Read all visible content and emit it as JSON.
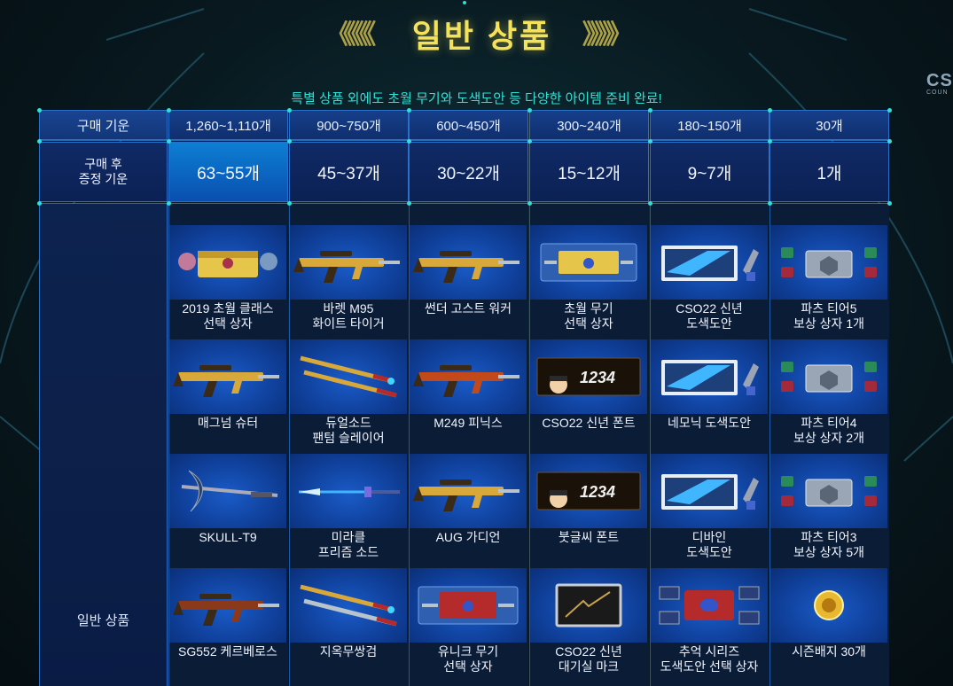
{
  "header": {
    "title": "일반 상품",
    "left_deco": "《《《《",
    "right_deco": "》》》》",
    "subtitle": "특별 상품 외에도 초월 무기와 도색도안 등 다양한 아이템 준비 완료!"
  },
  "brand": {
    "text": "CS",
    "sub": "COUN"
  },
  "table": {
    "row_label_purchase": "구매 기운",
    "row_label_bonus_line1": "구매 후",
    "row_label_bonus_line2": "증정 기운",
    "section_label": "일반 상품",
    "columns": [
      {
        "purchase": "1,260~1,110개",
        "bonus": "63~55개"
      },
      {
        "purchase": "900~750개",
        "bonus": "45~37개"
      },
      {
        "purchase": "600~450개",
        "bonus": "30~22개"
      },
      {
        "purchase": "300~240개",
        "bonus": "15~12개"
      },
      {
        "purchase": "180~150개",
        "bonus": "9~7개"
      },
      {
        "purchase": "30개",
        "bonus": "1개"
      }
    ],
    "rows": [
      [
        {
          "line1": "2019 초월 클래스",
          "line2": "선택 상자",
          "icon": "gold-chest-icon"
        },
        {
          "line1": "바렛 M95",
          "line2": "화이트 타이거",
          "icon": "sniper-rifle-icon"
        },
        {
          "line1": "썬더 고스트 워커",
          "line2": "",
          "icon": "heavy-rifle-icon"
        },
        {
          "line1": "초월 무기",
          "line2": "선택 상자",
          "icon": "weapon-box-icon"
        },
        {
          "line1": "CSO22 신년",
          "line2": "도색도안",
          "icon": "paint-card-icon"
        },
        {
          "line1": "파츠 티어5",
          "line2": "보상 상자 1개",
          "icon": "parts-box-icon"
        }
      ],
      [
        {
          "line1": "매그넘 슈터",
          "line2": "",
          "icon": "magnum-launcher-icon"
        },
        {
          "line1": "듀얼소드",
          "line2": "팬텀 슬레이어",
          "icon": "dual-sword-icon"
        },
        {
          "line1": "M249 피닉스",
          "line2": "",
          "icon": "phoenix-mg-icon"
        },
        {
          "line1": "CSO22 신년 폰트",
          "line2": "",
          "icon": "font-card-icon"
        },
        {
          "line1": "네모닉 도색도안",
          "line2": "",
          "icon": "paint-card-icon"
        },
        {
          "line1": "파츠 티어4",
          "line2": "보상 상자 2개",
          "icon": "parts-box-icon"
        }
      ],
      [
        {
          "line1": "SKULL-T9",
          "line2": "",
          "icon": "axe-icon"
        },
        {
          "line1": "미라클",
          "line2": "프리즘 소드",
          "icon": "prism-sword-icon"
        },
        {
          "line1": "AUG 가디언",
          "line2": "",
          "icon": "assault-rifle-icon"
        },
        {
          "line1": "붓글씨 폰트",
          "line2": "",
          "icon": "font-card-icon"
        },
        {
          "line1": "디바인",
          "line2": "도색도안",
          "icon": "paint-card-icon"
        },
        {
          "line1": "파츠 티어3",
          "line2": "보상 상자 5개",
          "icon": "parts-box-icon"
        }
      ],
      [
        {
          "line1": "SG552 케르베로스",
          "line2": "",
          "icon": "rifle-icon"
        },
        {
          "line1": "지옥무쌍검",
          "line2": "",
          "icon": "dual-blade-icon"
        },
        {
          "line1": "유니크 무기",
          "line2": "선택 상자",
          "icon": "red-weapon-box-icon"
        },
        {
          "line1": "CSO22 신년",
          "line2": "대기실 마크",
          "icon": "lobby-mark-icon"
        },
        {
          "line1": "추억 시리즈",
          "line2": "도색도안 선택 상자",
          "icon": "red-paint-box-icon"
        },
        {
          "line1": "시즌배지 30개",
          "line2": "",
          "icon": "badge-coin-icon"
        }
      ]
    ]
  },
  "colors": {
    "title": "#f4e35a",
    "subtitle": "#2ee0d5",
    "header_bg": "#163f8a",
    "bonus_highlight": "#0c7fd2",
    "thumb_bg": "#1a5bc7"
  }
}
